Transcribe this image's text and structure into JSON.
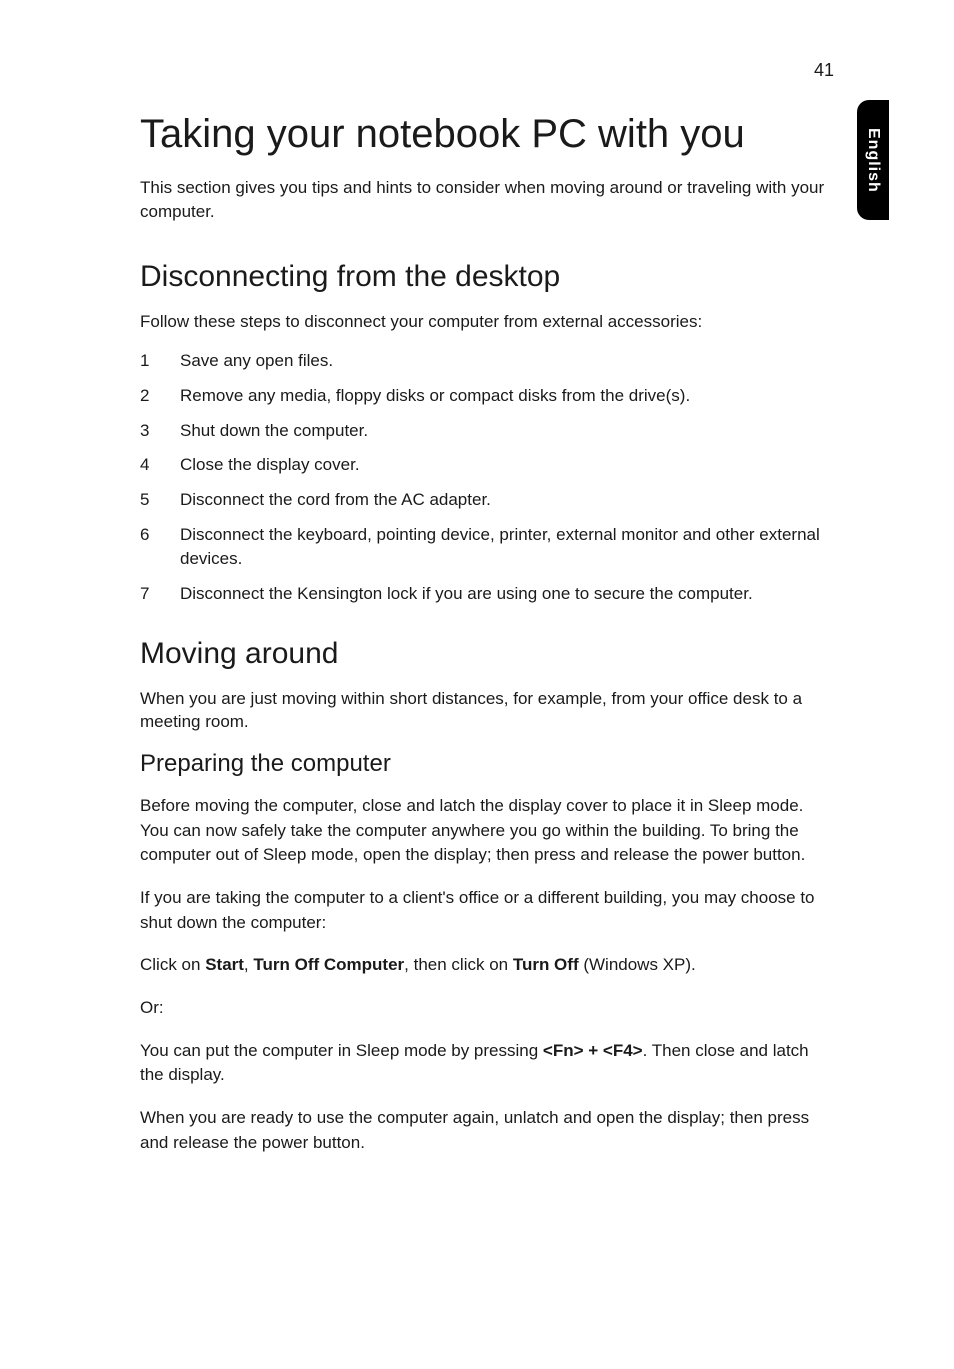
{
  "page_number": "41",
  "side_tab": "English",
  "h1": "Taking your notebook PC with you",
  "intro": "This section gives you tips and hints to consider when moving around or traveling with your computer.",
  "section1": {
    "heading": "Disconnecting from the desktop",
    "intro": "Follow these steps to disconnect your computer from external accessories:",
    "items": [
      {
        "n": "1",
        "t": "Save any open files."
      },
      {
        "n": "2",
        "t": "Remove any media, floppy disks or compact disks from the drive(s)."
      },
      {
        "n": "3",
        "t": "Shut down the computer."
      },
      {
        "n": "4",
        "t": "Close the display cover."
      },
      {
        "n": "5",
        "t": "Disconnect the cord from the AC adapter."
      },
      {
        "n": "6",
        "t": "Disconnect the keyboard, pointing device, printer, external monitor and other external devices."
      },
      {
        "n": "7",
        "t": "Disconnect the Kensington lock if you are using one to secure the computer."
      }
    ]
  },
  "section2": {
    "heading": "Moving around",
    "intro": "When you are just moving within short distances, for example, from your office desk to a meeting room.",
    "sub": {
      "heading": "Preparing the computer",
      "p1": "Before moving the computer, close and latch the display cover to place it in Sleep mode. You can now safely take the computer anywhere you go within the building. To bring the computer out of Sleep mode, open the display; then press and release the power button.",
      "p2": "If you are taking the computer to a client's office or a different building, you may choose to shut down the computer:",
      "p3_pre": "Click on ",
      "p3_b1": "Start",
      "p3_mid1": ", ",
      "p3_b2": "Turn Off Computer",
      "p3_mid2": ", then click on ",
      "p3_b3": "Turn Off",
      "p3_post": " (Windows XP).",
      "p4": "Or:",
      "p5_pre": "You can put the computer in Sleep mode by pressing ",
      "p5_b": "<Fn> + <F4>",
      "p5_post": ". Then close and latch the display.",
      "p6": "When you are ready to use the computer again, unlatch and open the display; then press and release the power button."
    }
  }
}
